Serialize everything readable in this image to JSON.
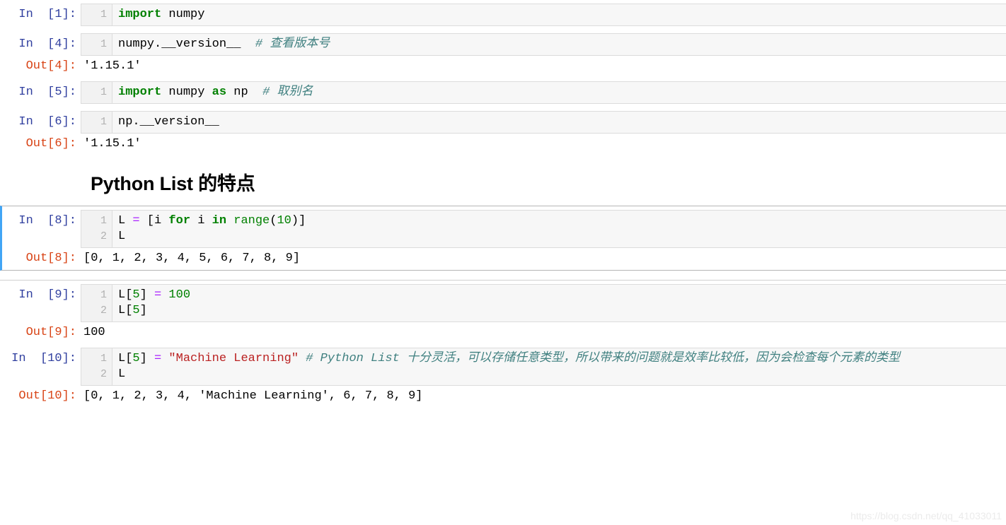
{
  "notebook": {
    "cells": [
      {
        "kind": "code",
        "in_prompt": "In  [1]:",
        "lines": [
          "1"
        ],
        "code_tokens": [
          [
            {
              "t": "import",
              "c": "kw"
            },
            {
              "t": " numpy",
              "c": "plain"
            }
          ]
        ],
        "output": null
      },
      {
        "kind": "code",
        "in_prompt": "In  [4]:",
        "lines": [
          "1"
        ],
        "code_tokens": [
          [
            {
              "t": "numpy.__version__",
              "c": "plain"
            },
            {
              "t": "  ",
              "c": "plain"
            },
            {
              "t": "# 查看版本号",
              "c": "cmt"
            }
          ]
        ],
        "out_prompt": "Out[4]:",
        "output": "'1.15.1'"
      },
      {
        "kind": "code",
        "in_prompt": "In  [5]:",
        "lines": [
          "1"
        ],
        "code_tokens": [
          [
            {
              "t": "import",
              "c": "kw"
            },
            {
              "t": " numpy ",
              "c": "plain"
            },
            {
              "t": "as",
              "c": "kw"
            },
            {
              "t": " np  ",
              "c": "plain"
            },
            {
              "t": "# 取别名",
              "c": "cmt"
            }
          ]
        ],
        "output": null
      },
      {
        "kind": "code",
        "in_prompt": "In  [6]:",
        "lines": [
          "1"
        ],
        "code_tokens": [
          [
            {
              "t": "np.__version__",
              "c": "plain"
            }
          ]
        ],
        "out_prompt": "Out[6]:",
        "output": "'1.15.1'"
      },
      {
        "kind": "markdown",
        "heading": "Python List 的特点"
      },
      {
        "kind": "code",
        "selected": true,
        "in_prompt": "In  [8]:",
        "lines": [
          "1",
          "2"
        ],
        "code_tokens": [
          [
            {
              "t": "L ",
              "c": "plain"
            },
            {
              "t": "=",
              "c": "op"
            },
            {
              "t": " [i ",
              "c": "plain"
            },
            {
              "t": "for",
              "c": "kw"
            },
            {
              "t": " i ",
              "c": "plain"
            },
            {
              "t": "in",
              "c": "kw"
            },
            {
              "t": " ",
              "c": "plain"
            },
            {
              "t": "range",
              "c": "bi"
            },
            {
              "t": "(",
              "c": "plain"
            },
            {
              "t": "10",
              "c": "num"
            },
            {
              "t": ")]",
              "c": "plain"
            }
          ],
          [
            {
              "t": "L",
              "c": "plain"
            }
          ]
        ],
        "out_prompt": "Out[8]:",
        "output": "[0, 1, 2, 3, 4, 5, 6, 7, 8, 9]"
      },
      {
        "kind": "code",
        "in_prompt": "In  [9]:",
        "lines": [
          "1",
          "2"
        ],
        "code_tokens": [
          [
            {
              "t": "L[",
              "c": "plain"
            },
            {
              "t": "5",
              "c": "num"
            },
            {
              "t": "] ",
              "c": "plain"
            },
            {
              "t": "=",
              "c": "op"
            },
            {
              "t": " ",
              "c": "plain"
            },
            {
              "t": "100",
              "c": "num"
            }
          ],
          [
            {
              "t": "L[",
              "c": "plain"
            },
            {
              "t": "5",
              "c": "num"
            },
            {
              "t": "]",
              "c": "plain"
            }
          ]
        ],
        "out_prompt": "Out[9]:",
        "output": "100"
      },
      {
        "kind": "code",
        "in_prompt": "In  [10]:",
        "lines": [
          "1",
          "2"
        ],
        "code_tokens": [
          [
            {
              "t": "L[",
              "c": "plain"
            },
            {
              "t": "5",
              "c": "num"
            },
            {
              "t": "] ",
              "c": "plain"
            },
            {
              "t": "=",
              "c": "op"
            },
            {
              "t": " ",
              "c": "plain"
            },
            {
              "t": "\"Machine Learning\"",
              "c": "str"
            },
            {
              "t": " ",
              "c": "plain"
            },
            {
              "t": "# Python List 十分灵活，可以存储任意类型，所以带来的问题就是效率比较低，因为会检查每个元素的类型",
              "c": "cmt"
            }
          ],
          [
            {
              "t": "L",
              "c": "plain"
            }
          ]
        ],
        "out_prompt": "Out[10]:",
        "output": "[0, 1, 2, 3, 4, 'Machine Learning', 6, 7, 8, 9]"
      }
    ]
  },
  "watermark": "https://blog.csdn.net/qq_41033011",
  "colors": {
    "prompt_in": "#303F9F",
    "prompt_out": "#D84315",
    "keyword": "#008000",
    "string": "#BA2121",
    "comment": "#408080",
    "operator": "#AA22FF",
    "selected_border": "#42a5f5",
    "code_bg": "#f7f7f7"
  }
}
